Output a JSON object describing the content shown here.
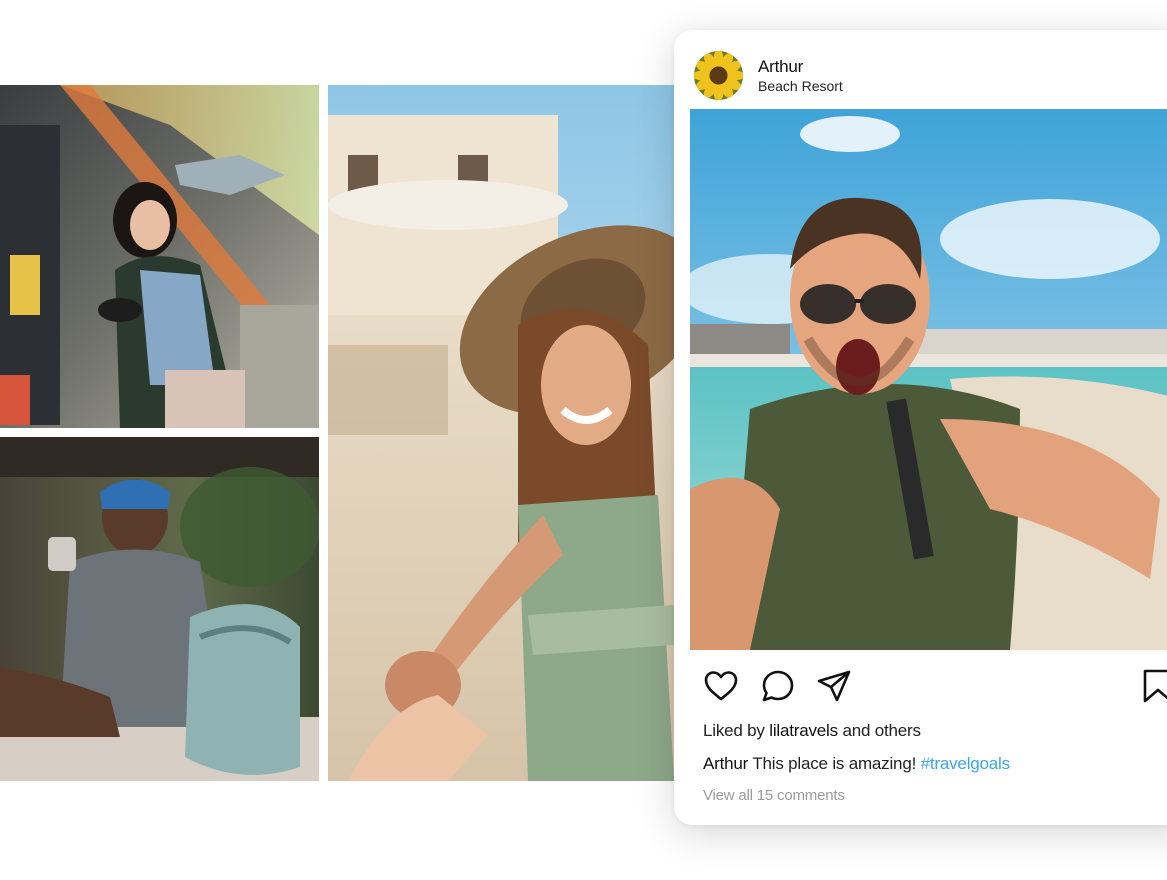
{
  "post": {
    "username": "Arthur",
    "location": "Beach Resort",
    "liked_by_prefix": "Liked by",
    "liked_by_user": "lilatravels",
    "liked_by_suffix": "and others",
    "caption_user": "Arthur",
    "caption_text": "This place is amazing!",
    "hashtag": "#travelgoals",
    "view_comments": "View all 15 comments",
    "hashtag_color": "#3ba6e6"
  },
  "icons": {
    "like": "heart-icon",
    "comment": "comment-bubble-icon",
    "share": "paper-plane-icon",
    "save": "bookmark-icon"
  }
}
